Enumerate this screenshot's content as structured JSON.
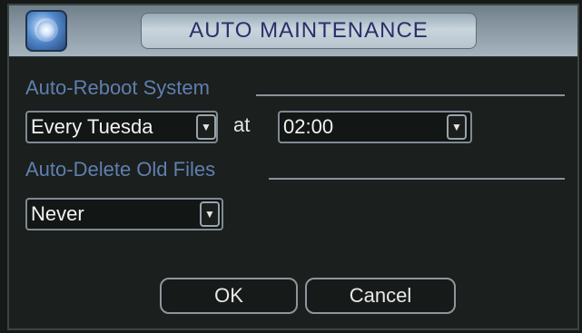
{
  "window": {
    "title": "AUTO MAINTENANCE"
  },
  "auto_reboot": {
    "label": "Auto-Reboot System",
    "day": "Every Tuesda",
    "at_label": "at",
    "time": "02:00"
  },
  "auto_delete": {
    "label": "Auto-Delete Old Files",
    "value": "Never"
  },
  "buttons": {
    "ok": "OK",
    "cancel": "Cancel"
  },
  "icons": {
    "dropdown_arrow": "chevron-down-icon",
    "app": "maintenance-app-icon"
  },
  "colors": {
    "section_label": "#5f7fb0",
    "title_text": "#2a2f6a",
    "background": "#1b1f1d"
  }
}
